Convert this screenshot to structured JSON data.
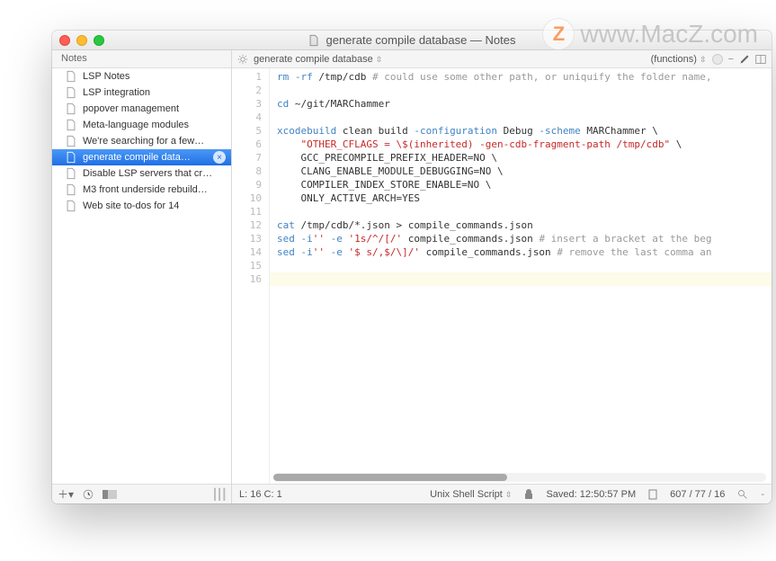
{
  "watermark": {
    "text": "www.MacZ.com"
  },
  "window": {
    "title": "generate compile database — Notes"
  },
  "sidebar": {
    "header": "Notes",
    "items": [
      {
        "label": "LSP Notes",
        "icon": "doc",
        "selected": false
      },
      {
        "label": "LSP integration",
        "icon": "doc",
        "selected": false
      },
      {
        "label": "popover management",
        "icon": "doc",
        "selected": false
      },
      {
        "label": "Meta-language modules",
        "icon": "doc",
        "selected": false
      },
      {
        "label": "We're searching for a few…",
        "icon": "doc",
        "selected": false
      },
      {
        "label": "generate compile data…",
        "icon": "doc",
        "selected": true
      },
      {
        "label": "Disable LSP servers that cr…",
        "icon": "doc",
        "selected": false
      },
      {
        "label": "M3 front underside rebuild…",
        "icon": "doc",
        "selected": false
      },
      {
        "label": "Web site to-dos for 14",
        "icon": "doc",
        "selected": false
      }
    ]
  },
  "editor": {
    "toolbar": {
      "path": "generate compile database",
      "functions_label": "(functions)"
    },
    "line_count": 16,
    "current_line": 16,
    "code_lines": [
      {
        "n": 1,
        "tokens": [
          [
            "cmd",
            "rm"
          ],
          [
            "opt",
            " -rf "
          ],
          [
            "path",
            "/tmp/cdb "
          ],
          [
            "cmt",
            "# could use some other path, or uniquify the folder name,"
          ]
        ]
      },
      {
        "n": 2,
        "tokens": []
      },
      {
        "n": 3,
        "tokens": [
          [
            "cmd",
            "cd "
          ],
          [
            "path",
            "~/git/MARChammer"
          ]
        ]
      },
      {
        "n": 4,
        "tokens": []
      },
      {
        "n": 5,
        "tokens": [
          [
            "cmd",
            "xcodebuild"
          ],
          [
            "path",
            " clean build "
          ],
          [
            "opt",
            "-configuration"
          ],
          [
            "path",
            " Debug "
          ],
          [
            "opt",
            "-scheme"
          ],
          [
            "path",
            " MARChammer \\"
          ]
        ]
      },
      {
        "n": 6,
        "tokens": [
          [
            "path",
            "    "
          ],
          [
            "str",
            "\"OTHER_CFLAGS = \\$(inherited) -gen-cdb-fragment-path /tmp/cdb\""
          ],
          [
            "path",
            " \\"
          ]
        ]
      },
      {
        "n": 7,
        "tokens": [
          [
            "path",
            "    GCC_PRECOMPILE_PREFIX_HEADER=NO \\"
          ]
        ]
      },
      {
        "n": 8,
        "tokens": [
          [
            "path",
            "    CLANG_ENABLE_MODULE_DEBUGGING=NO \\"
          ]
        ]
      },
      {
        "n": 9,
        "tokens": [
          [
            "path",
            "    COMPILER_INDEX_STORE_ENABLE=NO \\"
          ]
        ]
      },
      {
        "n": 10,
        "tokens": [
          [
            "path",
            "    ONLY_ACTIVE_ARCH=YES"
          ]
        ]
      },
      {
        "n": 11,
        "tokens": []
      },
      {
        "n": 12,
        "tokens": [
          [
            "cmd",
            "cat "
          ],
          [
            "path",
            "/tmp/cdb/*.json > compile_commands.json"
          ]
        ]
      },
      {
        "n": 13,
        "tokens": [
          [
            "cmd",
            "sed"
          ],
          [
            "opt",
            " -i"
          ],
          [
            "str",
            "''"
          ],
          [
            "opt",
            " -e "
          ],
          [
            "str",
            "'1s/^/[/'"
          ],
          [
            "path",
            " compile_commands.json "
          ],
          [
            "cmt",
            "# insert a bracket at the beg"
          ]
        ]
      },
      {
        "n": 14,
        "tokens": [
          [
            "cmd",
            "sed"
          ],
          [
            "opt",
            " -i"
          ],
          [
            "str",
            "''"
          ],
          [
            "opt",
            " -e "
          ],
          [
            "str",
            "'$ s/,$/\\]/'"
          ],
          [
            "path",
            " compile_commands.json "
          ],
          [
            "cmt",
            "# remove the last comma an"
          ]
        ]
      },
      {
        "n": 15,
        "tokens": []
      },
      {
        "n": 16,
        "tokens": []
      }
    ]
  },
  "statusbar": {
    "position": "L: 16 C: 1",
    "language": "Unix Shell Script",
    "saved_label": "Saved:",
    "saved_time": "12:50:57 PM",
    "counts": "607 / 77 / 16"
  }
}
